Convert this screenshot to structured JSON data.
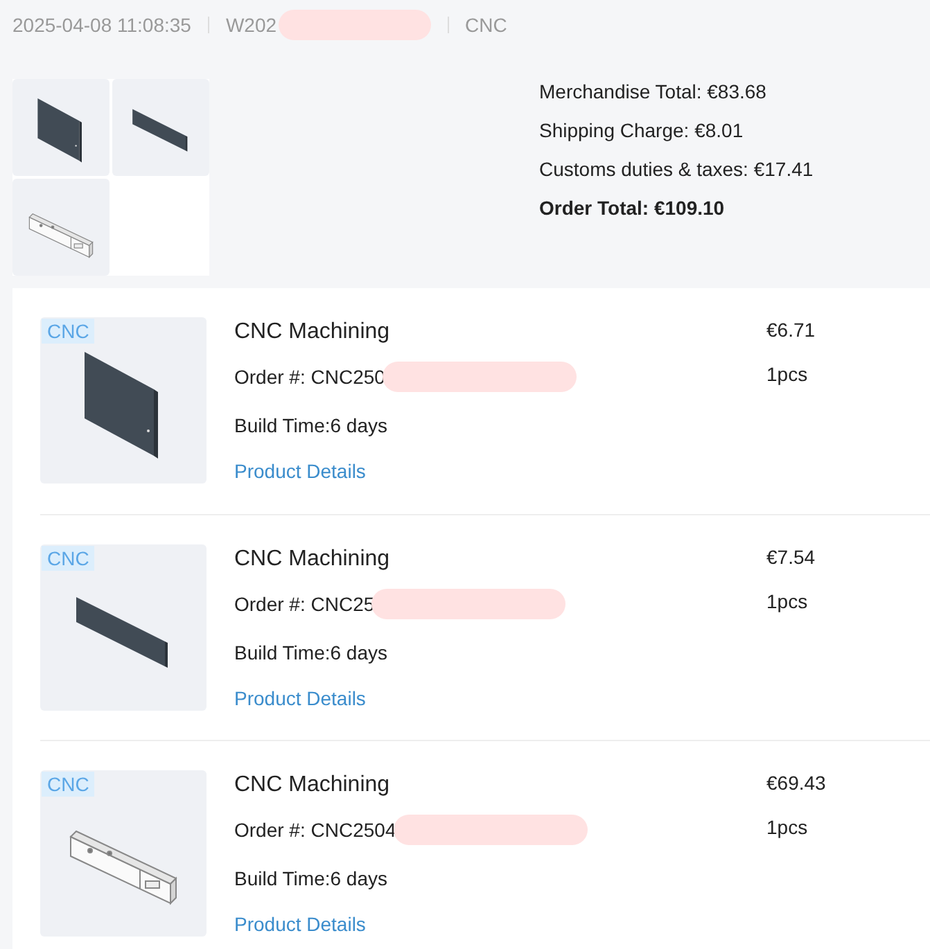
{
  "header": {
    "date": "2025-04-08 11:08:35",
    "order_id": "W202",
    "category": "CNC"
  },
  "thumbnails": [
    {
      "kind": "panel"
    },
    {
      "kind": "strip"
    },
    {
      "kind": "bracket"
    }
  ],
  "summary": {
    "lines": [
      "Merchandise Total: €83.68",
      "Shipping Charge: €8.01",
      "Customs duties & taxes: €17.41"
    ],
    "total": "Order Total: €109.10"
  },
  "items": [
    {
      "tag": "CNC",
      "kind": "panel",
      "title": "CNC Machining",
      "order_label": "Order #:",
      "order_no": "CNC250",
      "build_time": "Build Time:6 days",
      "link": "Product Details",
      "price": "€6.71",
      "qty": "1pcs"
    },
    {
      "tag": "CNC",
      "kind": "strip",
      "title": "CNC Machining",
      "order_label": "Order #:",
      "order_no": "CNC25",
      "build_time": "Build Time:6 days",
      "link": "Product Details",
      "price": "€7.54",
      "qty": "1pcs"
    },
    {
      "tag": "CNC",
      "kind": "bracket",
      "title": "CNC Machining",
      "order_label": "Order #:",
      "order_no": "CNC2504",
      "build_time": "Build Time:6 days",
      "link": "Product Details",
      "price": "€69.43",
      "qty": "1pcs"
    }
  ]
}
